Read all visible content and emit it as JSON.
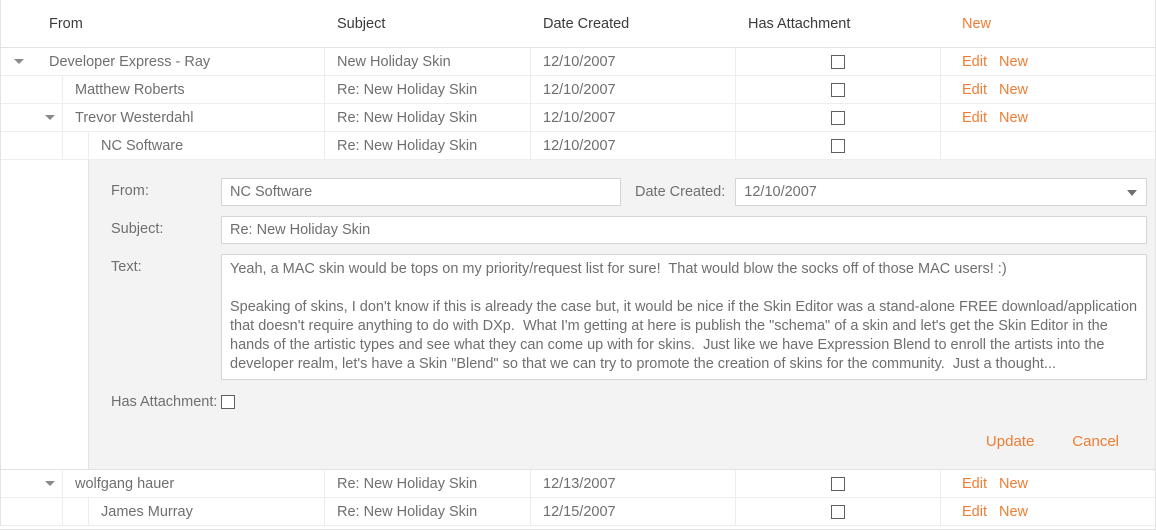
{
  "colors": {
    "accent": "#ee7d33",
    "text": "#6f6f6f",
    "header_text": "#3b3b3b",
    "border": "#e3e3e3",
    "panel_bg": "#f3f3f3"
  },
  "grid": {
    "columns": [
      {
        "key": "from",
        "label": "From"
      },
      {
        "key": "subject",
        "label": "Subject"
      },
      {
        "key": "date",
        "label": "Date Created"
      },
      {
        "key": "attach",
        "label": "Has Attachment"
      }
    ],
    "header_command": "New",
    "command_labels": {
      "edit": "Edit",
      "new": "New"
    },
    "rows": [
      {
        "from": "Developer Express - Ray",
        "subject": "New Holiday Skin",
        "date": "12/10/2007",
        "has_attachment": false,
        "level": 0,
        "expanded": true,
        "commands": [
          "Edit",
          "New"
        ]
      },
      {
        "from": "Matthew Roberts",
        "subject": "Re: New Holiday Skin",
        "date": "12/10/2007",
        "has_attachment": false,
        "level": 1,
        "expanded": null,
        "commands": [
          "Edit",
          "New"
        ]
      },
      {
        "from": "Trevor Westerdahl",
        "subject": "Re: New Holiday Skin",
        "date": "12/10/2007",
        "has_attachment": false,
        "level": 1,
        "expanded": true,
        "commands": [
          "Edit",
          "New"
        ]
      },
      {
        "from": "NC Software",
        "subject": "Re: New Holiday Skin",
        "date": "12/10/2007",
        "has_attachment": false,
        "level": 2,
        "expanded": null,
        "commands": []
      }
    ],
    "rows_after": [
      {
        "from": "wolfgang hauer",
        "subject": "Re: New Holiday Skin",
        "date": "12/13/2007",
        "has_attachment": false,
        "level": 1,
        "expanded": true,
        "commands": [
          "Edit",
          "New"
        ]
      },
      {
        "from": "James Murray",
        "subject": "Re: New Holiday Skin",
        "date": "12/15/2007",
        "has_attachment": false,
        "level": 2,
        "expanded": null,
        "commands": [
          "Edit",
          "New"
        ]
      }
    ]
  },
  "edit_form": {
    "labels": {
      "from": "From:",
      "date_created": "Date Created:",
      "subject": "Subject:",
      "text": "Text:",
      "has_attachment": "Has Attachment:"
    },
    "values": {
      "from": "NC Software",
      "date_created": "12/10/2007",
      "subject": "Re: New Holiday Skin",
      "text": "Yeah, a MAC skin would be tops on my priority/request list for sure!  That would blow the socks off of those MAC users! :)\n\nSpeaking of skins, I don't know if this is already the case but, it would be nice if the Skin Editor was a stand-alone FREE download/application that doesn't require anything to do with DXp.  What I'm getting at here is publish the \"schema\" of a skin and let's get the Skin Editor in the hands of the artistic types and see what they can come up with for skins.  Just like we have Expression Blend to enroll the artists into the developer realm, let's have a Skin \"Blend\" so that we can try to promote the creation of skins for the community.  Just a thought...",
      "has_attachment": false
    },
    "buttons": {
      "update": "Update",
      "cancel": "Cancel"
    }
  }
}
